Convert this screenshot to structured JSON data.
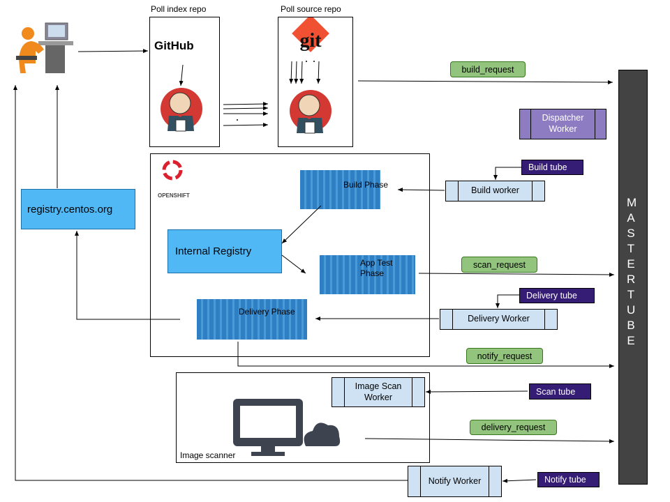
{
  "poll_index": {
    "label": "Poll index repo",
    "logo": "GitHub"
  },
  "poll_source": {
    "label": "Poll source repo",
    "logo": "git"
  },
  "requests": {
    "build": "build_request",
    "scan": "scan_request",
    "notify": "notify_request",
    "delivery": "delivery_request"
  },
  "workers": {
    "dispatcher": "Dispatcher Worker",
    "build": "Build worker",
    "delivery": "Delivery Worker",
    "image_scan": "Image Scan Worker",
    "notify": "Notify Worker"
  },
  "tubes": {
    "build": "Build tube",
    "delivery": "Delivery tube",
    "scan": "Scan tube",
    "notify": "Notify tube"
  },
  "master_tube": "MASTER TUBE",
  "openshift": {
    "logo": "OPENSHIFT",
    "build_phase": "Build Phase",
    "app_test_phase": "App Test Phase",
    "delivery_phase": "Delivery Phase",
    "internal_registry": "Internal Registry"
  },
  "registry": "registry.centos.org",
  "image_scanner": "Image scanner",
  "colors": {
    "master_tube": "#434343",
    "dispatcher": "#8e7cc3",
    "tube": "#351c75",
    "worker": "#cfe2f3",
    "request": "#93c47d",
    "registry": "#4fb8f5",
    "container": "#2f7fc4"
  }
}
